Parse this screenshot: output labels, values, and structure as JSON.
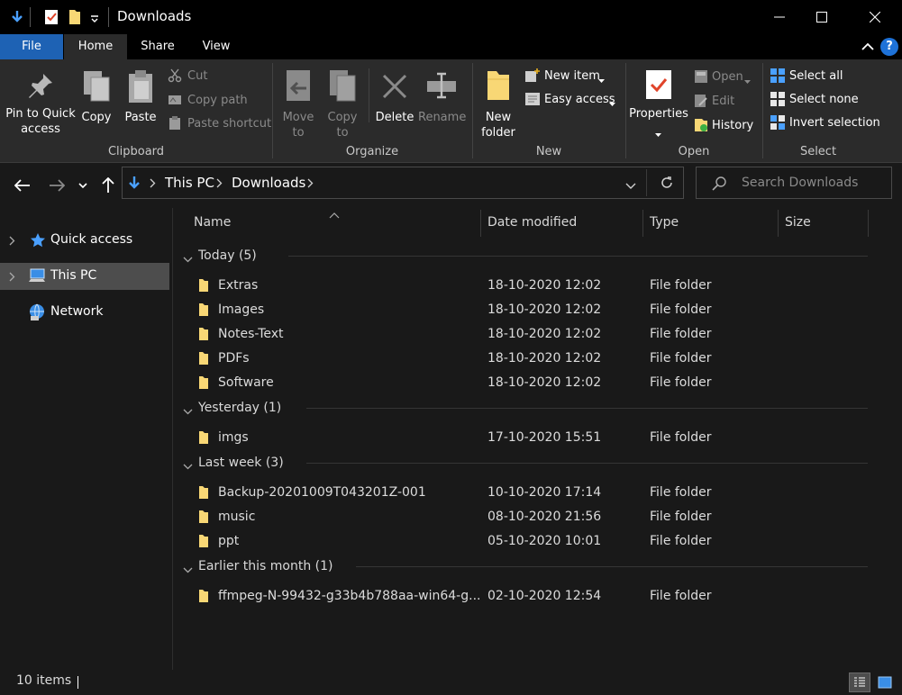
{
  "window": {
    "title": "Downloads",
    "quick_access_toolbar": [
      "down-arrow-icon",
      "properties-icon",
      "folder-icon",
      "customize-dropdown-icon"
    ]
  },
  "ribbon": {
    "tabs": [
      {
        "label": "File",
        "active": false
      },
      {
        "label": "Home",
        "active": true
      },
      {
        "label": "Share",
        "active": false
      },
      {
        "label": "View",
        "active": false
      }
    ],
    "help": "?",
    "groups": {
      "clipboard": {
        "label": "Clipboard",
        "pin_to_quick_access": "Pin to Quick access",
        "copy": "Copy",
        "paste": "Paste",
        "cut": "Cut",
        "copy_path": "Copy path",
        "paste_shortcut": "Paste shortcut"
      },
      "organize": {
        "label": "Organize",
        "move_to": "Move to",
        "copy_to": "Copy to",
        "delete": "Delete",
        "rename": "Rename"
      },
      "new": {
        "label": "New",
        "new_folder": "New folder",
        "new_item": "New item",
        "easy_access": "Easy access"
      },
      "open": {
        "label": "Open",
        "properties": "Properties",
        "open": "Open",
        "edit": "Edit",
        "history": "History"
      },
      "select": {
        "label": "Select",
        "select_all": "Select all",
        "select_none": "Select none",
        "invert_selection": "Invert selection"
      }
    }
  },
  "address": {
    "breadcrumb": [
      "This PC",
      "Downloads"
    ],
    "search_placeholder": "Search Downloads"
  },
  "sidebar": {
    "items": [
      {
        "label": "Quick access",
        "icon": "star-icon",
        "selected": false
      },
      {
        "label": "This PC",
        "icon": "computer-icon",
        "selected": true
      },
      {
        "label": "Network",
        "icon": "network-icon",
        "selected": false
      }
    ]
  },
  "columns": [
    "Name",
    "Date modified",
    "Type",
    "Size"
  ],
  "groups": [
    {
      "label": "Today (5)",
      "rows": [
        {
          "name": "Extras",
          "date": "18-10-2020 12:02",
          "type": "File folder"
        },
        {
          "name": "Images",
          "date": "18-10-2020 12:02",
          "type": "File folder"
        },
        {
          "name": "Notes-Text",
          "date": "18-10-2020 12:02",
          "type": "File folder"
        },
        {
          "name": "PDFs",
          "date": "18-10-2020 12:02",
          "type": "File folder"
        },
        {
          "name": "Software",
          "date": "18-10-2020 12:02",
          "type": "File folder"
        }
      ]
    },
    {
      "label": "Yesterday (1)",
      "rows": [
        {
          "name": "imgs",
          "date": "17-10-2020 15:51",
          "type": "File folder"
        }
      ]
    },
    {
      "label": "Last week (3)",
      "rows": [
        {
          "name": "Backup-20201009T043201Z-001",
          "date": "10-10-2020 17:14",
          "type": "File folder"
        },
        {
          "name": "music",
          "date": "08-10-2020 21:56",
          "type": "File folder"
        },
        {
          "name": "ppt",
          "date": "05-10-2020 10:01",
          "type": "File folder"
        }
      ]
    },
    {
      "label": "Earlier this month (1)",
      "rows": [
        {
          "name": "ffmpeg-N-99432-g33b4b788aa-win64-g...",
          "date": "02-10-2020 12:54",
          "type": "File folder"
        }
      ]
    }
  ],
  "status": {
    "item_count": "10 items"
  },
  "colors": {
    "accent": "#1e62b4",
    "folder": "#f8d775",
    "background": "#191919",
    "ribbon": "#2b2b2b"
  }
}
